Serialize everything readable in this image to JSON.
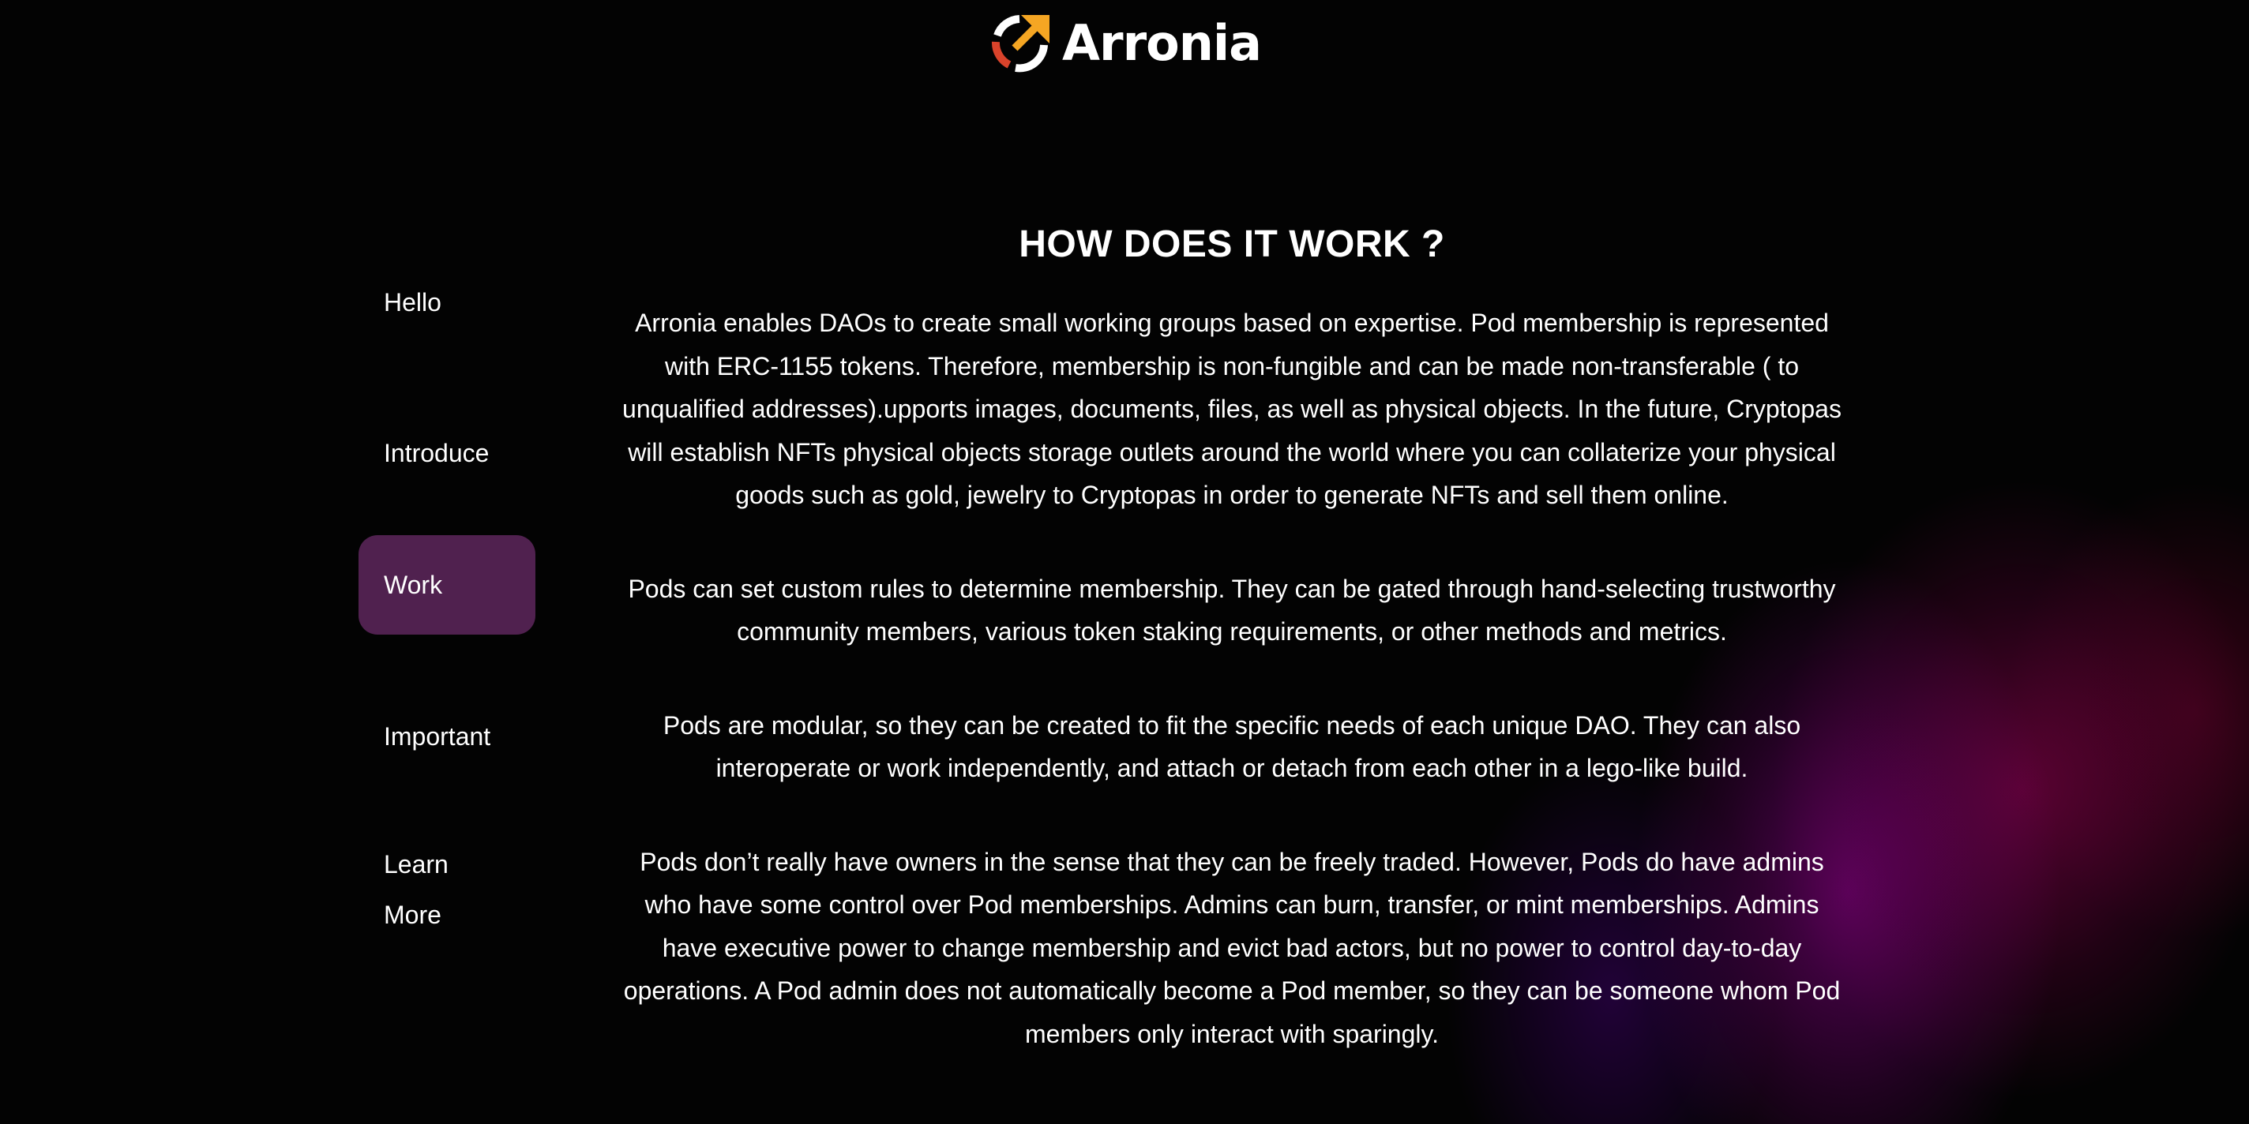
{
  "brand": {
    "name": "Arronia",
    "colors": {
      "orange": "#f5a623",
      "red": "#d9432b",
      "accent_active": "#50214f"
    }
  },
  "nav": {
    "items": [
      {
        "label": "Hello",
        "active": false
      },
      {
        "label": "Introduce",
        "active": false
      },
      {
        "label": "Work",
        "active": true
      },
      {
        "label": "Important",
        "active": false
      },
      {
        "label": "Learn More",
        "active": false
      }
    ]
  },
  "main": {
    "title": "HOW DOES IT WORK ?",
    "paragraphs": [
      "Arronia enables DAOs to create small working groups based on expertise. Pod membership is represented with ERC-1155 tokens. Therefore, membership is non-fungible and can be made non-transferable ( to unqualified addresses).upports images, documents, files, as well as physical objects. In the future, Cryptopas will establish NFTs physical objects storage outlets around the world where you can collaterize your physical goods such as gold, jewelry to Cryptopas in order to generate NFTs and sell them online.",
      "Pods can set custom rules to determine membership. They can be gated through hand-selecting trustworthy community members, various token staking requirements, or other methods and metrics.",
      "Pods are modular, so they can be created to fit the specific needs of each unique DAO. They can also interoperate or work independently, and attach or detach from each other in a lego-like build.",
      "Pods don’t really have owners in the sense that they can be freely traded. However, Pods do have admins who have some control over Pod memberships. Admins can burn, transfer, or mint memberships. Admins have executive power to change membership and evict bad actors, but no power to control day-to-day operations. A Pod admin does not automatically become a Pod member, so they can be someone whom Pod members only interact with sparingly."
    ]
  }
}
